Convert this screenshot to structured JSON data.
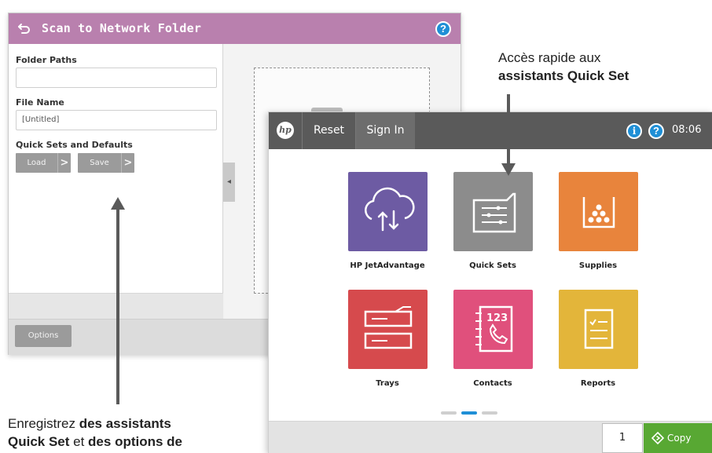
{
  "scan_window": {
    "title": "Scan to Network Folder",
    "help_label": "?",
    "folder_paths_label": "Folder Paths",
    "folder_paths_value": "",
    "file_name_label": "File Name",
    "file_name_value": "[Untitled]",
    "quick_sets_label": "Quick Sets and Defaults",
    "load_label": "Load",
    "save_label": "Save",
    "options_label": "Options",
    "chevron": ">",
    "collapse_glyph": "◂",
    "header_color": "#b980ae"
  },
  "home_window": {
    "logo_text": "hp",
    "reset_label": "Reset",
    "sign_in_label": "Sign In",
    "info_label": "i",
    "help_label": "?",
    "time": "08:06",
    "apps": [
      {
        "label": "HP JetAdvantage",
        "color": "#6d5ba3",
        "icon": "cloud-sync-icon"
      },
      {
        "label": "Quick Sets",
        "color": "#8c8c8c",
        "icon": "folder-settings-icon"
      },
      {
        "label": "Supplies",
        "color": "#e8843c",
        "icon": "toner-icon"
      },
      {
        "label": "Trays",
        "color": "#d64a4d",
        "icon": "paper-tray-icon"
      },
      {
        "label": "Contacts",
        "color": "#e0507c",
        "icon": "address-book-icon"
      },
      {
        "label": "Reports",
        "color": "#e3b53a",
        "icon": "checklist-icon"
      }
    ],
    "page_indicator": {
      "pages": 3,
      "current": 2
    },
    "copies": "1",
    "copy_label": "Copy",
    "accent_color": "#1f8fd6",
    "copy_color": "#58a833"
  },
  "annotations": {
    "top_right_line1": "Accès rapide aux",
    "top_right_line2": "assistants Quick Set",
    "bottom_left_line1_regular": "Enregistrez ",
    "bottom_left_line1_bold": "des assistants",
    "bottom_left_line2_bold_a": "Quick Set",
    "bottom_left_line2_regular": " et ",
    "bottom_left_line2_bold_b": "des options de"
  }
}
